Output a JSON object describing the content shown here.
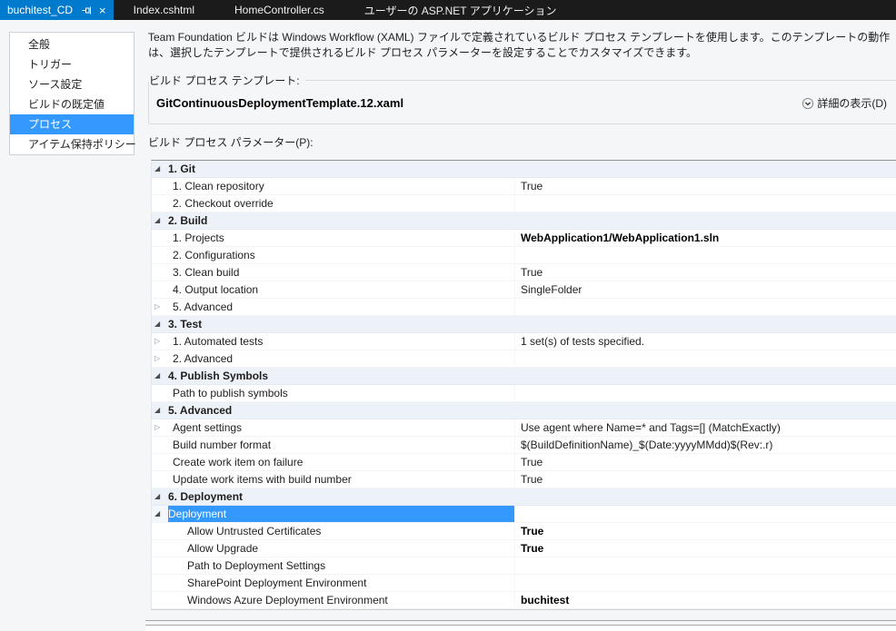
{
  "tabs": [
    {
      "label": "buchitest_CD",
      "active": true
    },
    {
      "label": "Index.cshtml",
      "active": false
    },
    {
      "label": "HomeController.cs",
      "active": false
    },
    {
      "label": "ユーザーの ASP.NET アプリケーション",
      "active": false
    }
  ],
  "sidebar": {
    "items": [
      {
        "label": "全般",
        "selected": false
      },
      {
        "label": "トリガー",
        "selected": false
      },
      {
        "label": "ソース設定",
        "selected": false
      },
      {
        "label": "ビルドの既定値",
        "selected": false
      },
      {
        "label": "プロセス",
        "selected": true
      },
      {
        "label": "アイテム保持ポリシー",
        "selected": false
      }
    ]
  },
  "description": "Team Foundation ビルドは Windows Workflow (XAML) ファイルで定義されているビルド プロセス テンプレートを使用します。このテンプレートの動作は、選択したテンプレートで提供されるビルド プロセス パラメーターを設定することでカスタマイズできます。",
  "template_section": {
    "label": "ビルド プロセス テンプレート:",
    "template_name": "GitContinuousDeploymentTemplate.12.xaml",
    "details_link": "詳細の表示(D)"
  },
  "parameters_label": "ビルド プロセス パラメーター(P):",
  "icons": {
    "expanded_glyph": "◢",
    "collapsed_glyph": "▷",
    "close_glyph": "×"
  },
  "colors": {
    "active_tab": "#007acc",
    "selection": "#3399ff",
    "tabbar_bg": "#1b1b1c",
    "group_row_bg": "#edf2f9"
  },
  "grid": {
    "rows": [
      {
        "type": "group",
        "expander": "expanded",
        "label": "1. Git",
        "value": "",
        "bold_value": false,
        "selected": false
      },
      {
        "type": "item",
        "expander": "",
        "label": "1. Clean repository",
        "value": "True",
        "bold_value": false,
        "selected": false
      },
      {
        "type": "item",
        "expander": "",
        "label": "2. Checkout override",
        "value": "",
        "bold_value": false,
        "selected": false
      },
      {
        "type": "group",
        "expander": "expanded",
        "label": "2. Build",
        "value": "",
        "bold_value": false,
        "selected": false
      },
      {
        "type": "item",
        "expander": "",
        "label": "1. Projects",
        "value": "WebApplication1/WebApplication1.sln",
        "bold_value": true,
        "selected": false
      },
      {
        "type": "item",
        "expander": "",
        "label": "2. Configurations",
        "value": "",
        "bold_value": false,
        "selected": false
      },
      {
        "type": "item",
        "expander": "",
        "label": "3. Clean build",
        "value": "True",
        "bold_value": false,
        "selected": false
      },
      {
        "type": "item",
        "expander": "",
        "label": "4. Output location",
        "value": "SingleFolder",
        "bold_value": false,
        "selected": false
      },
      {
        "type": "item",
        "expander": "collapsed",
        "label": "5. Advanced",
        "value": "",
        "bold_value": false,
        "selected": false
      },
      {
        "type": "group",
        "expander": "expanded",
        "label": "3. Test",
        "value": "",
        "bold_value": false,
        "selected": false
      },
      {
        "type": "item",
        "expander": "collapsed",
        "label": "1. Automated tests",
        "value": "1 set(s) of tests specified.",
        "bold_value": false,
        "selected": false
      },
      {
        "type": "item",
        "expander": "collapsed",
        "label": "2. Advanced",
        "value": "",
        "bold_value": false,
        "selected": false
      },
      {
        "type": "group",
        "expander": "expanded",
        "label": "4. Publish Symbols",
        "value": "",
        "bold_value": false,
        "selected": false
      },
      {
        "type": "item",
        "expander": "",
        "label": "Path to publish symbols",
        "value": "",
        "bold_value": false,
        "selected": false
      },
      {
        "type": "group",
        "expander": "expanded",
        "label": "5. Advanced",
        "value": "",
        "bold_value": false,
        "selected": false
      },
      {
        "type": "item",
        "expander": "collapsed",
        "label": "Agent settings",
        "value": "Use agent where Name=* and Tags=[] (MatchExactly)",
        "bold_value": false,
        "selected": false
      },
      {
        "type": "item",
        "expander": "",
        "label": "Build number format",
        "value": "$(BuildDefinitionName)_$(Date:yyyyMMdd)$(Rev:.r)",
        "bold_value": false,
        "selected": false
      },
      {
        "type": "item",
        "expander": "",
        "label": "Create work item on failure",
        "value": "True",
        "bold_value": false,
        "selected": false
      },
      {
        "type": "item",
        "expander": "",
        "label": "Update work items with build number",
        "value": "True",
        "bold_value": false,
        "selected": false
      },
      {
        "type": "group",
        "expander": "expanded",
        "label": "6. Deployment",
        "value": "",
        "bold_value": false,
        "selected": false
      },
      {
        "type": "subgroup",
        "expander": "expanded",
        "label": "Deployment",
        "value": "",
        "bold_value": false,
        "selected": true
      },
      {
        "type": "subitem",
        "expander": "",
        "label": "Allow Untrusted Certificates",
        "value": "True",
        "bold_value": true,
        "selected": false
      },
      {
        "type": "subitem",
        "expander": "",
        "label": "Allow Upgrade",
        "value": "True",
        "bold_value": true,
        "selected": false
      },
      {
        "type": "subitem",
        "expander": "",
        "label": "Path to Deployment Settings",
        "value": "",
        "bold_value": false,
        "selected": false
      },
      {
        "type": "subitem",
        "expander": "",
        "label": "SharePoint Deployment Environment",
        "value": "",
        "bold_value": false,
        "selected": false
      },
      {
        "type": "subitem",
        "expander": "",
        "label": "Windows Azure Deployment Environment",
        "value": "buchitest",
        "bold_value": true,
        "selected": false
      }
    ]
  }
}
